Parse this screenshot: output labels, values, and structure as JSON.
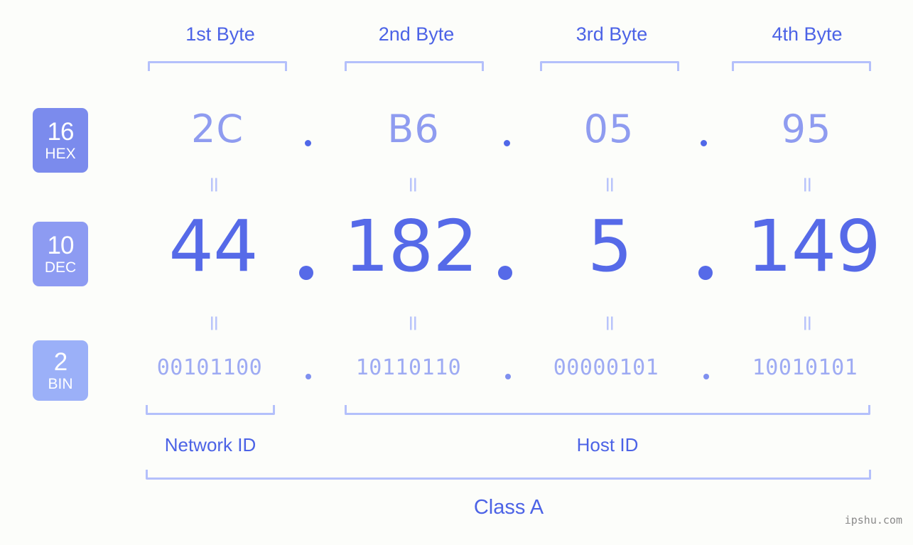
{
  "page": {
    "background_color": "#fcfdfa",
    "accent_color": "#4c63e6",
    "bracket_color": "#b4c0fb",
    "watermark": "ipshu.com"
  },
  "byte_headers": [
    {
      "label": "1st Byte"
    },
    {
      "label": "2nd Byte"
    },
    {
      "label": "3rd Byte"
    },
    {
      "label": "4th Byte"
    }
  ],
  "bases": [
    {
      "num": "16",
      "abbr": "HEX",
      "color": "#7b8bed"
    },
    {
      "num": "10",
      "abbr": "DEC",
      "color": "#8d9bf2"
    },
    {
      "num": "2",
      "abbr": "BIN",
      "color": "#9bb0f8"
    }
  ],
  "rows": {
    "hex": {
      "values": [
        "2C",
        "B6",
        "05",
        "95"
      ],
      "separator": "."
    },
    "dec": {
      "values": [
        "44",
        "182",
        "5",
        "149"
      ],
      "separator": "."
    },
    "bin": {
      "values": [
        "00101100",
        "10110110",
        "00000101",
        "10010101"
      ],
      "separator": "."
    }
  },
  "equals": {
    "glyph": "=",
    "between_hex_dec": [
      "=",
      "=",
      "=",
      "="
    ],
    "between_dec_bin": [
      "=",
      "=",
      "=",
      "="
    ]
  },
  "sections": [
    {
      "label": "Network ID"
    },
    {
      "label": "Host ID"
    }
  ],
  "class": {
    "label": "Class A"
  },
  "chart_data": {
    "type": "table",
    "title": "IP Address Byte Breakdown",
    "ip_decimal": "44.182.5.149",
    "ip_hex": "2C.B6.05.95",
    "ip_binary": "00101100.10110110.00000101.10010101",
    "ip_class": "Class A",
    "network_id_bytes": 1,
    "host_id_bytes": 3,
    "columns": [
      "1st Byte",
      "2nd Byte",
      "3rd Byte",
      "4th Byte"
    ],
    "series": [
      {
        "name": "HEX (base 16)",
        "values": [
          "2C",
          "B6",
          "05",
          "95"
        ]
      },
      {
        "name": "DEC (base 10)",
        "values": [
          "44",
          "182",
          "5",
          "149"
        ]
      },
      {
        "name": "BIN (base 2)",
        "values": [
          "00101100",
          "10110110",
          "00000101",
          "10010101"
        ]
      }
    ]
  }
}
